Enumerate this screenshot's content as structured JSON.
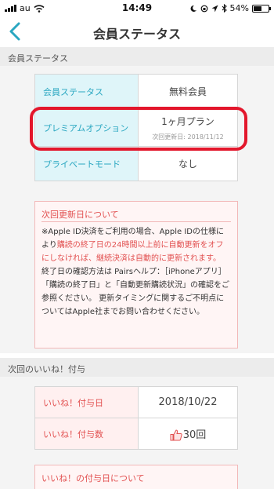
{
  "status_bar": {
    "carrier": "au",
    "time": "14:49",
    "battery": "54%",
    "battery_level": 0.54
  },
  "nav": {
    "title": "会員ステータス"
  },
  "section1": {
    "header": "会員ステータス",
    "rows": [
      {
        "label": "会員ステータス",
        "value": "無料会員"
      },
      {
        "label": "プレミアムオプション",
        "value": "1ヶ月プラン",
        "sub": "次回更新日: 2018/11/12"
      },
      {
        "label": "プライベートモード",
        "value": "なし"
      }
    ],
    "notice": {
      "title": "次回更新日について",
      "p1": "※Apple ID決済をご利用の場合、Apple IDの仕様により",
      "p1_red": "購読の終了日の24時間以上前に自動更新をオフにしなければ、継続決済は自動的に更新されます。",
      "p2": " 終了日の確認方法は Pairsヘルプ：［iPhoneアプリ］「購読の終了日」と「自動更新購読状況」の確認をご参照ください。 更新タイミングに関するご不明点についてはApple社までお問い合わせください。"
    }
  },
  "section2": {
    "header": "次回のいいね！付与",
    "rows": [
      {
        "label": "いいね！付与日",
        "value": "2018/10/22"
      },
      {
        "label": "いいね！付与数",
        "value": "30回"
      }
    ],
    "notice_title": "いいね！の付与日について"
  }
}
